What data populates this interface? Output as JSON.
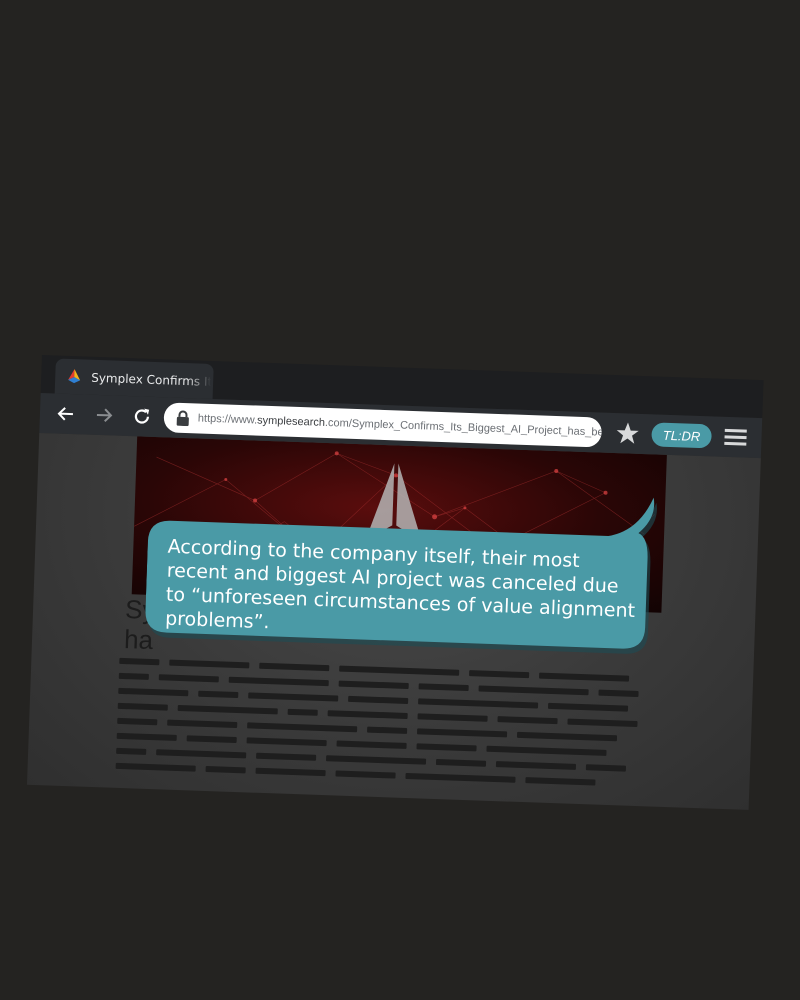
{
  "tab": {
    "title": "Symplex Confirms Its Biggest AI Project has been"
  },
  "address_bar": {
    "url_prefix": "https://www.",
    "url_domain": "symplesearch",
    "url_rest": ".com/Symplex_Confirms_Its_Biggest_AI_Project_has_been"
  },
  "toolbar": {
    "tldr_label": "TL:DR"
  },
  "article": {
    "headline_line1": "Sy",
    "headline_line2": "ha"
  },
  "bubble": {
    "text": "According to the company itself, their most recent and biggest AI project was canceled due to “unforeseen circumstances of value alignment problems”."
  },
  "colors": {
    "accent": "#4a9aa6",
    "page_bg": "#242321",
    "hero": "#5a0d0d"
  }
}
